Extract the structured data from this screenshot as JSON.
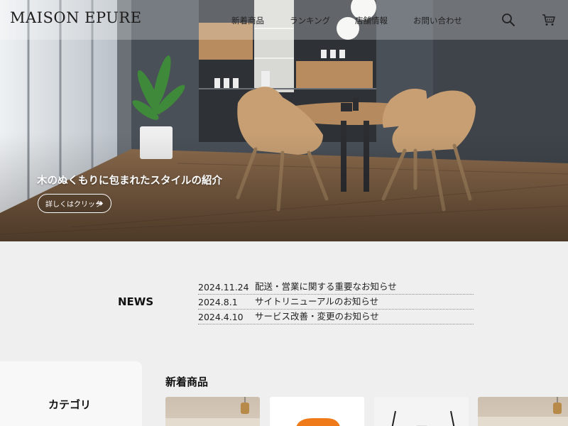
{
  "header": {
    "logo": "MAISON EPURE",
    "nav": [
      "新着商品",
      "ランキング",
      "店舗情報",
      "お問い合わせ"
    ],
    "icons": [
      "search-icon",
      "cart-icon"
    ]
  },
  "hero": {
    "title": "木のぬくもりに包まれたスタイルの紹介",
    "button_label": "詳しくはクリック",
    "button_icon": "arrow-right-icon"
  },
  "news": {
    "heading": "NEWS",
    "items": [
      {
        "date": "2024.11.24",
        "text": "配送・営業に関する重要なお知らせ"
      },
      {
        "date": "2024.8.1",
        "text": "サイトリニューアルのお知らせ"
      },
      {
        "date": "2024.4.10",
        "text": "サービス改善・変更のお知らせ"
      }
    ]
  },
  "category": {
    "title": "カテゴリ"
  },
  "new_arrivals": {
    "heading": "新着商品"
  },
  "colors": {
    "page_bg": "#efefef",
    "wood": "#a9825a",
    "chair": "#c79f73"
  }
}
